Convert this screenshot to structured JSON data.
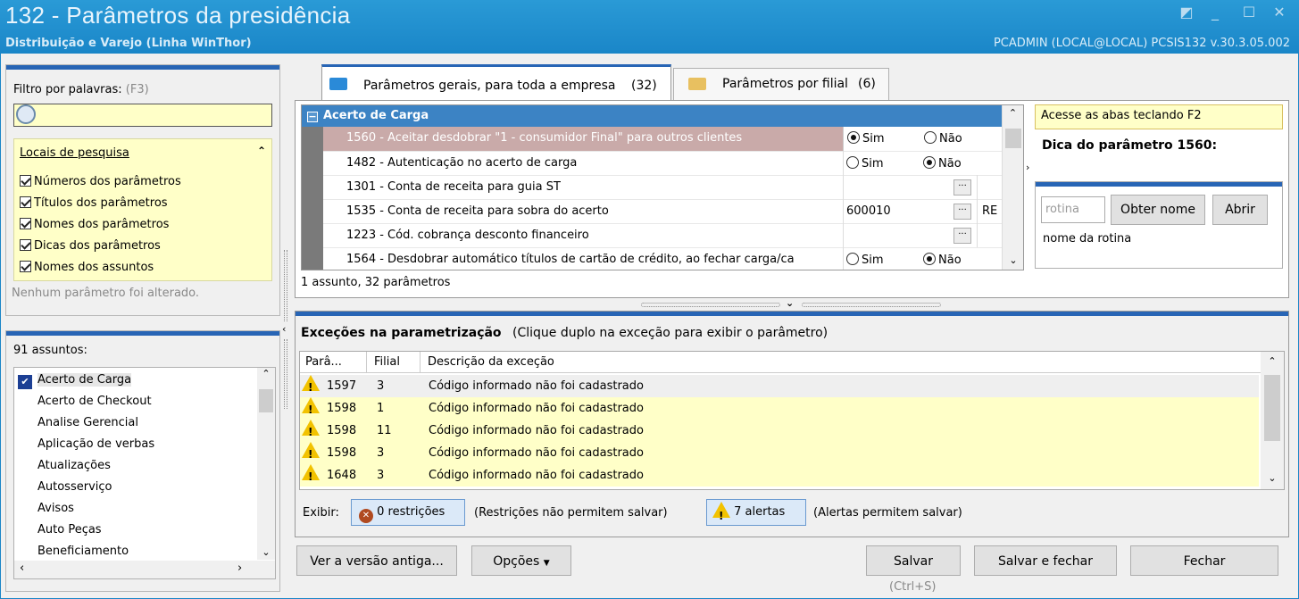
{
  "window": {
    "title": "132 - Parâmetros da presidência",
    "subtitle": "Distribuição e Varejo (Linha WinThor)",
    "userinfo": "PCADMIN (LOCAL@LOCAL)  PCSIS132  v.30.3.05.002"
  },
  "filter": {
    "label": "Filtro por palavras:",
    "hint": "(F3)",
    "value": ""
  },
  "search_locations": {
    "title": "Locais de pesquisa",
    "options": [
      "Números dos parâmetros",
      "Títulos dos parâmetros",
      "Nomes dos parâmetros",
      "Dicas dos parâmetros",
      "Nomes dos assuntos"
    ]
  },
  "status_text": "Nenhum parâmetro foi alterado.",
  "subjects": {
    "count_label": "91 assuntos:",
    "items": [
      "Acerto de Carga",
      "Acerto de Checkout",
      "Analise Gerencial",
      "Aplicação de verbas",
      "Atualizações",
      "Autosserviço",
      "Avisos",
      "Auto Peças",
      "Beneficiamento"
    ]
  },
  "tabs": [
    {
      "label": "Parâmetros gerais, para toda a empresa",
      "count": "(32)"
    },
    {
      "label": "Parâmetros por filial",
      "count": "(6)"
    }
  ],
  "grid": {
    "group": "Acerto de Carga",
    "rows": [
      {
        "label": "1560 - Aceitar desdobrar \"1 - consumidor Final\" para outros clientes",
        "kind": "radio",
        "value": "Sim"
      },
      {
        "label": "1482 - Autenticação no acerto de carga",
        "kind": "radio",
        "value": "Não"
      },
      {
        "label": "1301 - Conta de receita para guia ST",
        "kind": "lookup",
        "value": "",
        "extra": ""
      },
      {
        "label": "1535 - Conta de receita para sobra do acerto",
        "kind": "lookup",
        "value": "600010",
        "extra": "RE"
      },
      {
        "label": "1223 - Cód. cobrança desconto financeiro",
        "kind": "lookup",
        "value": "",
        "extra": ""
      },
      {
        "label": "1564 - Desdobrar automático títulos de cartão de crédito, ao fechar carga/ca",
        "kind": "radio",
        "value": "Não"
      }
    ],
    "sim": "Sim",
    "nao": "Não",
    "summary": "1 assunto, 32 parâmetros"
  },
  "tip": {
    "hint": "Acesse as abas teclando F2",
    "title": "Dica do parâmetro 1560:",
    "routine_placeholder": "rotina",
    "get_name": "Obter nome",
    "open": "Abrir",
    "routine_name": "nome da rotina"
  },
  "exceptions": {
    "title": "Exceções na parametrização",
    "subtitle": "(Clique duplo na exceção para exibir o parâmetro)",
    "columns": [
      "Parâ...",
      "Filial",
      "Descrição da exceção"
    ],
    "rows": [
      {
        "param": "1597",
        "filial": "3",
        "desc": "Código informado não foi cadastrado"
      },
      {
        "param": "1598",
        "filial": "1",
        "desc": "Código informado não foi cadastrado"
      },
      {
        "param": "1598",
        "filial": "11",
        "desc": "Código informado não foi cadastrado"
      },
      {
        "param": "1598",
        "filial": "3",
        "desc": "Código informado não foi cadastrado"
      },
      {
        "param": "1648",
        "filial": "3",
        "desc": "Código informado não foi cadastrado"
      }
    ],
    "show_label": "Exibir:",
    "restrictions": "0 restrições",
    "restrictions_note": "(Restrições não permitem salvar)",
    "alerts": "7 alertas",
    "alerts_note": "(Alertas permitem salvar)"
  },
  "footer": {
    "old_version": "Ver a versão antiga...",
    "options": "Opções",
    "save": "Salvar",
    "save_hint": "(Ctrl+S)",
    "save_close": "Salvar e fechar",
    "close": "Fechar"
  }
}
